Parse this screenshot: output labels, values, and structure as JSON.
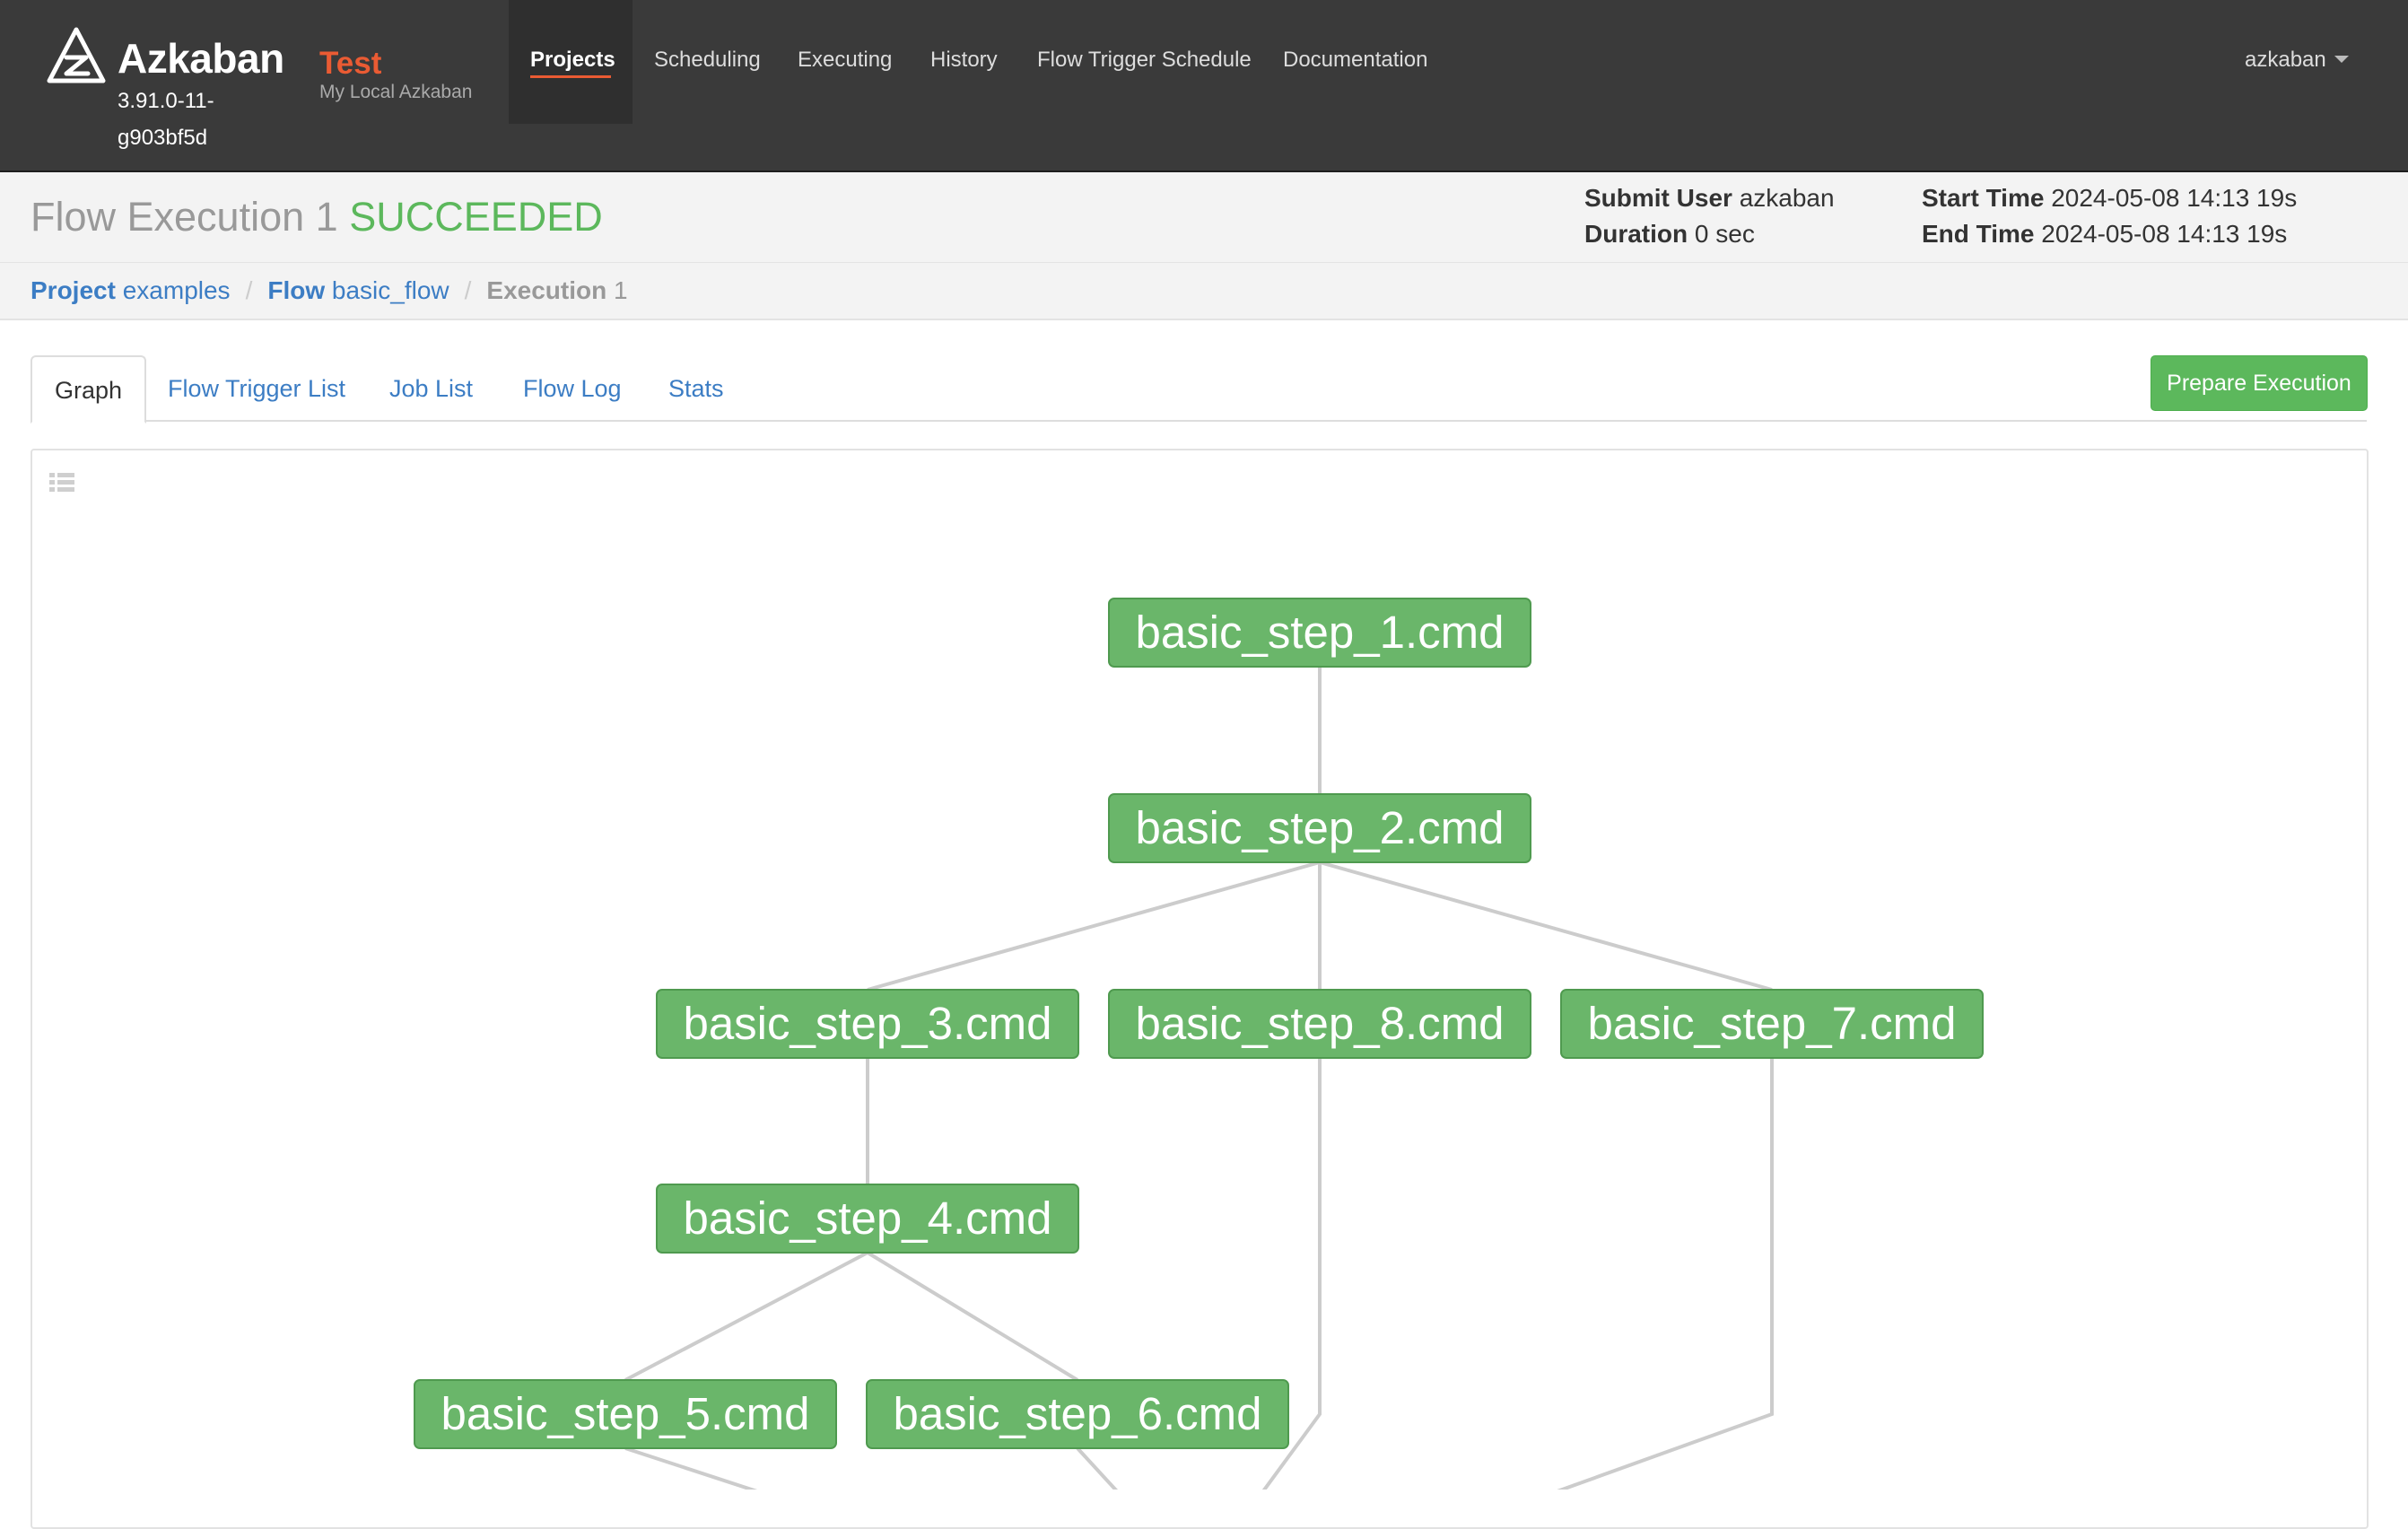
{
  "app": {
    "name": "Azkaban",
    "version": "3.91.0-11-g903bf5d",
    "env_name": "Test",
    "env_desc": "My Local Azkaban"
  },
  "nav": {
    "items": [
      {
        "label": "Projects",
        "active": true
      },
      {
        "label": "Scheduling",
        "active": false
      },
      {
        "label": "Executing",
        "active": false
      },
      {
        "label": "History",
        "active": false
      },
      {
        "label": "Flow Trigger Schedule",
        "active": false
      },
      {
        "label": "Documentation",
        "active": false
      }
    ],
    "user": "azkaban"
  },
  "execution": {
    "title_prefix": "Flow Execution",
    "id": "1",
    "status": "SUCCEEDED",
    "status_color": "#5cb85c",
    "submit_user_label": "Submit User",
    "submit_user": "azkaban",
    "duration_label": "Duration",
    "duration": "0 sec",
    "start_time_label": "Start Time",
    "start_time": "2024-05-08 14:13 19s",
    "end_time_label": "End Time",
    "end_time": "2024-05-08 14:13 19s"
  },
  "breadcrumb": {
    "project_label": "Project",
    "project": "examples",
    "flow_label": "Flow",
    "flow": "basic_flow",
    "execution_label": "Execution",
    "execution": "1"
  },
  "tabs": [
    {
      "label": "Graph",
      "active": true
    },
    {
      "label": "Flow Trigger List",
      "active": false
    },
    {
      "label": "Job List",
      "active": false
    },
    {
      "label": "Flow Log",
      "active": false
    },
    {
      "label": "Stats",
      "active": false
    }
  ],
  "actions": {
    "prepare_execution": "Prepare Execution"
  },
  "graph": {
    "node_status_color": "#6ab66a",
    "list_toggle_icon": "list-icon",
    "nodes": [
      {
        "id": "basic_step_1.cmd",
        "status": "SUCCEEDED"
      },
      {
        "id": "basic_step_2.cmd",
        "status": "SUCCEEDED"
      },
      {
        "id": "basic_step_3.cmd",
        "status": "SUCCEEDED"
      },
      {
        "id": "basic_step_8.cmd",
        "status": "SUCCEEDED"
      },
      {
        "id": "basic_step_7.cmd",
        "status": "SUCCEEDED"
      },
      {
        "id": "basic_step_4.cmd",
        "status": "SUCCEEDED"
      },
      {
        "id": "basic_step_5.cmd",
        "status": "SUCCEEDED"
      },
      {
        "id": "basic_step_6.cmd",
        "status": "SUCCEEDED"
      }
    ],
    "edges": [
      [
        "basic_step_1.cmd",
        "basic_step_2.cmd"
      ],
      [
        "basic_step_2.cmd",
        "basic_step_3.cmd"
      ],
      [
        "basic_step_2.cmd",
        "basic_step_8.cmd"
      ],
      [
        "basic_step_2.cmd",
        "basic_step_7.cmd"
      ],
      [
        "basic_step_3.cmd",
        "basic_step_4.cmd"
      ],
      [
        "basic_step_4.cmd",
        "basic_step_5.cmd"
      ],
      [
        "basic_step_4.cmd",
        "basic_step_6.cmd"
      ]
    ]
  }
}
